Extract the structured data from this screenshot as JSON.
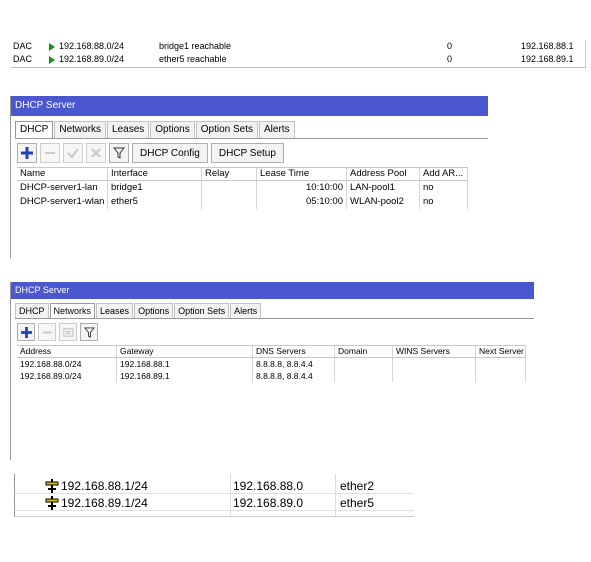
{
  "routes": [
    {
      "flag": "DAC",
      "dst_address": "192.168.88.0/24",
      "gateway": "bridge1 reachable",
      "distance": "0",
      "pref_source": "192.168.88.1"
    },
    {
      "flag": "DAC",
      "dst_address": "192.168.89.0/24",
      "gateway": "ether5 reachable",
      "distance": "0",
      "pref_source": "192.168.89.1"
    }
  ],
  "dhcp_window": {
    "title": "DHCP Server",
    "tabs": [
      "DHCP",
      "Networks",
      "Leases",
      "Options",
      "Option Sets",
      "Alerts"
    ],
    "active_tab": "DHCP",
    "toolbar": {
      "config_label": "DHCP Config",
      "setup_label": "DHCP Setup"
    },
    "columns": [
      "Name",
      "Interface",
      "Relay",
      "Lease Time",
      "Address Pool",
      "Add AR..."
    ],
    "rows": [
      {
        "name": "DHCP-server1-lan",
        "interface": "bridge1",
        "relay": "",
        "lease_time": "10:10:00",
        "address_pool": "LAN-pool1",
        "add_arp": "no"
      },
      {
        "name": "DHCP-server1-wlan",
        "interface": "ether5",
        "relay": "",
        "lease_time": "05:10:00",
        "address_pool": "WLAN-pool2",
        "add_arp": "no"
      }
    ]
  },
  "networks_window": {
    "title": "DHCP Server",
    "tabs": [
      "DHCP",
      "Networks",
      "Leases",
      "Options",
      "Option Sets",
      "Alerts"
    ],
    "active_tab": "Networks",
    "columns": [
      "Address",
      "Gateway",
      "DNS Servers",
      "Domain",
      "WINS Servers",
      "Next Server"
    ],
    "rows": [
      {
        "address": "192.168.88.0/24",
        "gateway": "192.168.88.1",
        "dns": "8.8.8.8, 8.8.4.4",
        "domain": "",
        "wins": "",
        "next_server": ""
      },
      {
        "address": "192.168.89.0/24",
        "gateway": "192.168.89.1",
        "dns": "8.8.8.8, 8.8.4.4",
        "domain": "",
        "wins": "",
        "next_server": ""
      }
    ]
  },
  "addresses": [
    {
      "address": "192.168.88.1/24",
      "network": "192.168.88.0",
      "interface": "ether2"
    },
    {
      "address": "192.168.89.1/24",
      "network": "192.168.89.0",
      "interface": "ether5"
    }
  ],
  "colors": {
    "titlebar": "#4a57cf",
    "route_arrow": "#1a8f1a",
    "add_button": "#1f3fbf",
    "address_icon": "#d7c200"
  },
  "icons": [
    "route-arrow-icon",
    "add-icon",
    "remove-icon",
    "enable-icon",
    "disable-icon",
    "filter-icon",
    "comment-icon",
    "address-icon"
  ]
}
